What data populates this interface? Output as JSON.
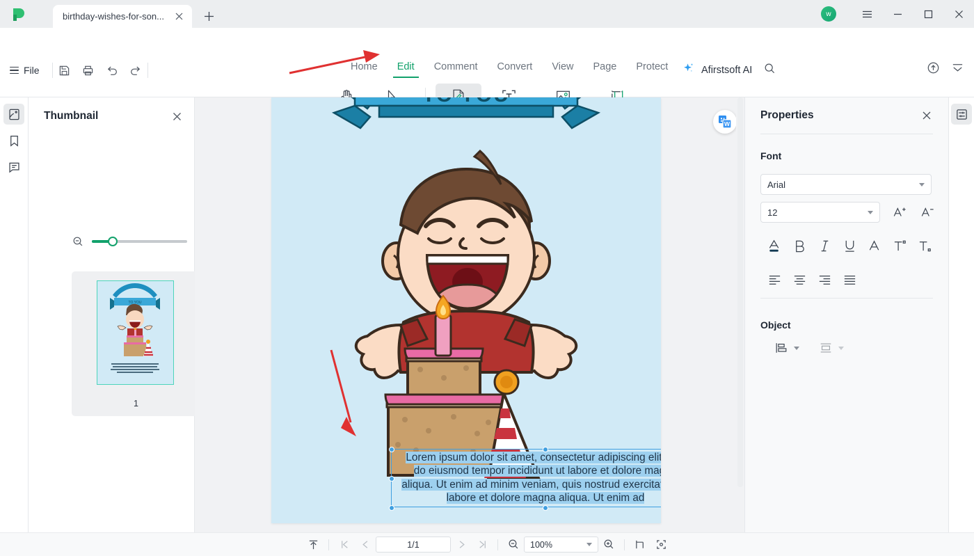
{
  "window": {
    "tab_title": "birthday-wishes-for-son...",
    "new_tab_icon": "plus-icon",
    "avatar_initial": "w",
    "minimize_icon": "minimize-icon",
    "maximize_icon": "maximize-icon",
    "close_icon": "close-icon",
    "menu_icon": "hamburger-icon"
  },
  "quickbar": {
    "file_label": "File",
    "icons": [
      "save-icon",
      "print-icon",
      "undo-icon",
      "redo-icon"
    ]
  },
  "menubar": {
    "items": [
      {
        "label": "Home",
        "active": false
      },
      {
        "label": "Edit",
        "active": true
      },
      {
        "label": "Comment",
        "active": false
      },
      {
        "label": "Convert",
        "active": false
      },
      {
        "label": "View",
        "active": false
      },
      {
        "label": "Page",
        "active": false
      },
      {
        "label": "Protect",
        "active": false
      }
    ]
  },
  "toolbar": {
    "tools": [
      {
        "label": "Hand",
        "icon": "hand-icon",
        "selected": false
      },
      {
        "label": "Select",
        "icon": "cursor-arrow-icon",
        "selected": false
      },
      {
        "label": "Edit",
        "icon": "edit-page-icon",
        "selected": true
      },
      {
        "label": "Add Text",
        "icon": "add-text-icon",
        "selected": false
      },
      {
        "label": "Add Image",
        "icon": "add-image-icon",
        "selected": false
      },
      {
        "label": "Crop Page",
        "icon": "crop-page-icon",
        "selected": false
      }
    ]
  },
  "ai": {
    "label": "Afirstsoft AI",
    "sparkle_icon": "sparkle-icon",
    "search_icon": "search-icon"
  },
  "header_right": {
    "cloud_icon": "cloud-upload-icon",
    "collapse_icon": "collapse-ribbon-icon"
  },
  "left_rail": {
    "items": [
      {
        "name": "thumbnail-panel",
        "icon": "page-thumbnail-icon",
        "selected": true
      },
      {
        "name": "bookmark-panel",
        "icon": "bookmark-icon",
        "selected": false
      },
      {
        "name": "comment-panel",
        "icon": "comment-icon",
        "selected": false
      }
    ]
  },
  "thumbnail_panel": {
    "title": "Thumbnail",
    "close_icon": "close-icon",
    "zoom_out_icon": "zoom-out-icon",
    "zoom_in_icon": "zoom-in-icon",
    "slider_value": 17,
    "pages": [
      {
        "number": "1",
        "selected": true
      }
    ]
  },
  "document": {
    "banner_text": "TO YOU",
    "body_text": "Lorem ipsum dolor sit amet, consectetur adipiscing elit, sed do eiusmod tempor incididunt ut labore et dolore magna aliqua. Ut enim ad minim veniam, quis nostrud exercitation ut labore et dolore magna aliqua. Ut enim ad",
    "body_lines": [
      "Lorem ipsum dolor sit amet, consectetur adipiscing elit, sed",
      "do eiusmod tempor incididunt ut labore et dolore magna",
      "aliqua. Ut enim ad minim veniam, quis nostrud exercitation ut",
      "labore et dolore magna aliqua. Ut enim ad"
    ],
    "convert_badge_icon": "convert-to-word-icon",
    "page_background": "#d1eaf6",
    "selection_color": "#9dd0ef",
    "selection_border": "#3f9fe0",
    "annotation_color": "#e03131"
  },
  "properties": {
    "title": "Properties",
    "close_icon": "close-icon",
    "font": {
      "section_label": "Font",
      "family_value": "Arial",
      "size_value": "12",
      "increase_icon": "increase-font-size-icon",
      "decrease_icon": "decrease-font-size-icon",
      "format_icons": [
        "font-color-icon",
        "bold-icon",
        "italic-icon",
        "underline-icon",
        "strikethrough-icon",
        "superscript-icon",
        "subscript-icon"
      ],
      "align_icons": [
        "align-left-icon",
        "align-center-icon",
        "align-right-icon",
        "align-justify-icon"
      ]
    },
    "object": {
      "section_label": "Object",
      "align_objects_icon": "align-objects-icon",
      "arrange_objects_icon": "arrange-objects-icon"
    }
  },
  "right_rail": {
    "items": [
      {
        "name": "properties-panel",
        "icon": "properties-sliders-icon",
        "selected": true
      }
    ]
  },
  "statusbar": {
    "scroll_top_icon": "scroll-to-top-icon",
    "first_page_icon": "first-page-icon",
    "prev_page_icon": "previous-page-icon",
    "page_value": "1/1",
    "next_page_icon": "next-page-icon",
    "last_page_icon": "last-page-icon",
    "zoom_out_icon": "zoom-out-icon",
    "zoom_value": "100%",
    "zoom_in_icon": "zoom-in-icon",
    "fit_width_icon": "fit-width-icon",
    "fit_page_icon": "fit-page-icon"
  },
  "colors": {
    "accent_green": "#12a16b",
    "annotation_red": "#e03131",
    "selection_blue": "#3f9fe0",
    "page_blue": "#d1eaf6"
  }
}
